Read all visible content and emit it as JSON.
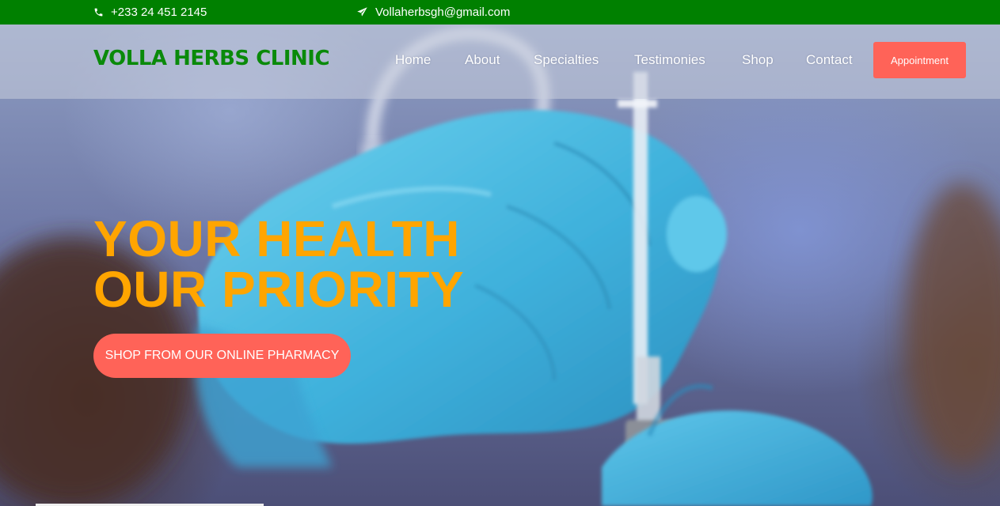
{
  "topbar": {
    "phone": "+233 24 451 2145",
    "email": "Vollaherbsgh@gmail.com",
    "phone_icon": "phone-icon",
    "email_icon": "paper-plane-icon",
    "background_color": "#008000"
  },
  "header": {
    "brand": "VOLLA HERBS CLINIC",
    "brand_color": "#0a8a0a",
    "nav": {
      "home": "Home",
      "about": "About",
      "specialties": "Specialties",
      "testimonies": "Testimonies",
      "shop": "Shop",
      "contact": "Contact"
    },
    "appointment_label": "Appointment"
  },
  "hero": {
    "headline_line1": "YOUR HEALTH",
    "headline_line2": "OUR PRIORITY",
    "headline_color": "#ffa500",
    "cta_label": "SHOP FROM OUR ONLINE PHARMACY",
    "cta_color": "#ff6358",
    "background_image": "gloved hand holding syringe"
  }
}
